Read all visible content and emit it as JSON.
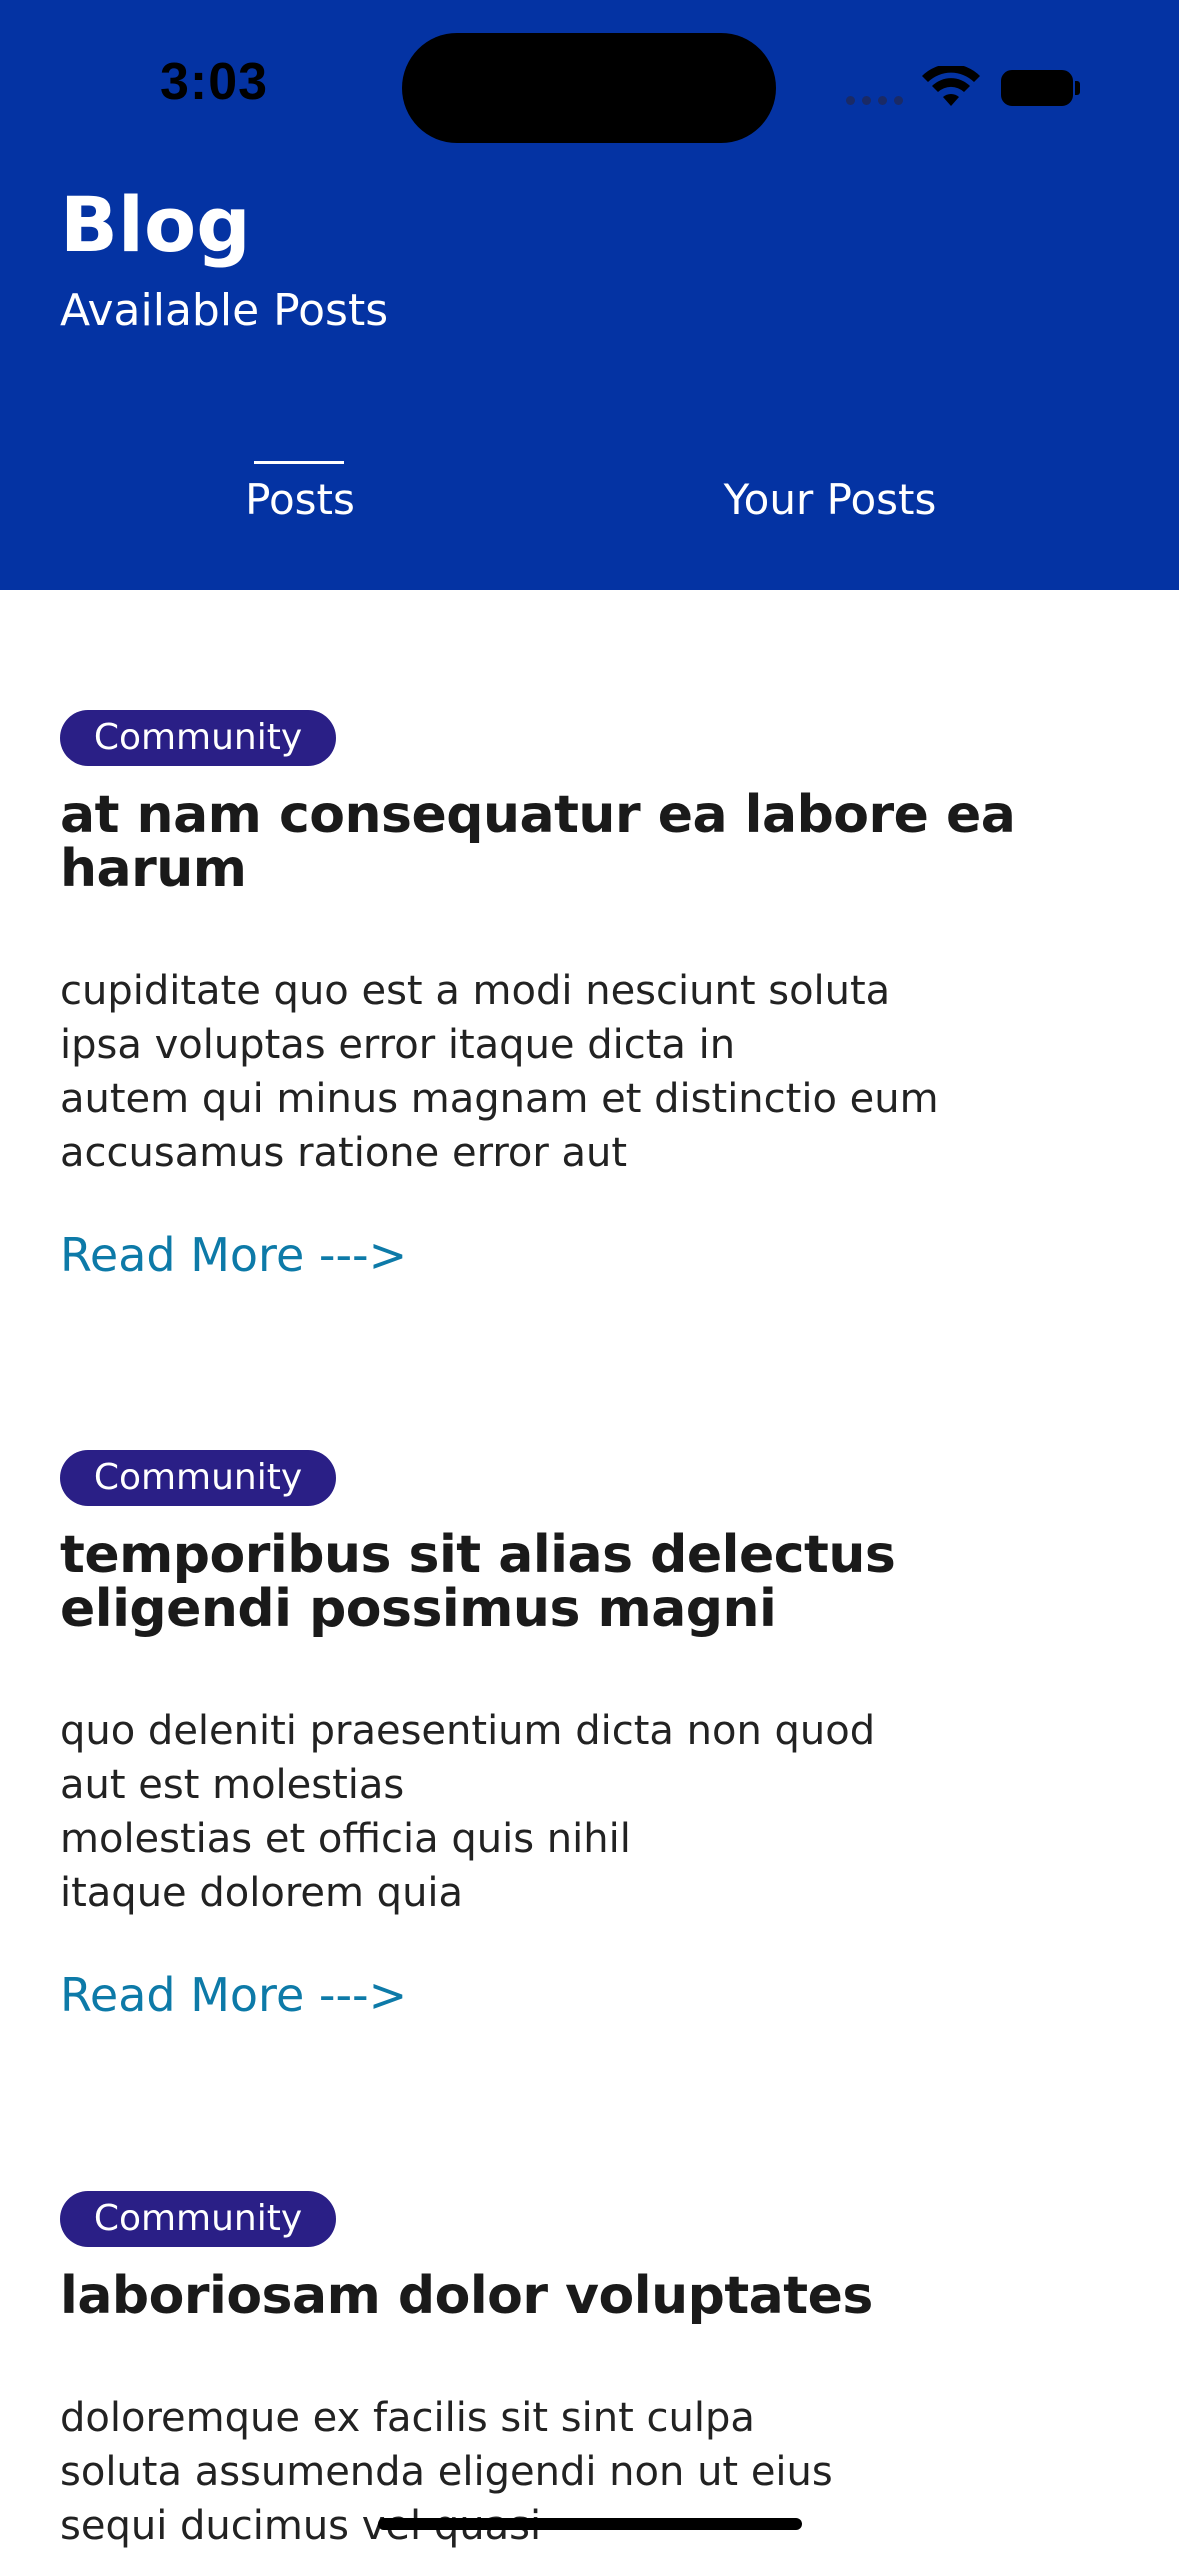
{
  "status_bar": {
    "time": "3:03"
  },
  "header": {
    "title": "Blog",
    "subtitle": "Available Posts",
    "background": "#0433a3"
  },
  "tabs": [
    {
      "label": "Posts",
      "selected": true
    },
    {
      "label": "Your Posts",
      "selected": false
    }
  ],
  "posts": [
    {
      "category": "Community",
      "title": "at nam consequatur ea labore ea harum",
      "body": [
        "cupiditate quo est a modi nesciunt soluta",
        "ipsa voluptas error itaque dicta in",
        "autem qui minus magnam et distinctio eum",
        "accusamus ratione error aut"
      ],
      "link": "Read More --->"
    },
    {
      "category": "Community",
      "title": "temporibus sit alias delectus eligendi possimus magni",
      "body": [
        "quo deleniti praesentium dicta non quod",
        "aut est molestias",
        "molestias et officia quis nihil",
        "itaque dolorem quia"
      ],
      "link": "Read More --->"
    },
    {
      "category": "Community",
      "title": "laboriosam dolor voluptates",
      "body": [
        "doloremque ex facilis sit sint culpa",
        "soluta assumenda eligendi non ut eius",
        "sequi ducimus vel quasi"
      ],
      "link": ""
    }
  ],
  "colors": {
    "badge": "#2a1f86",
    "link": "#0d7aa8",
    "title": "#1a1a1a"
  },
  "icons": {
    "wifi": "wifi-icon",
    "battery": "battery-icon",
    "signal": "cellular-signal-icon"
  }
}
